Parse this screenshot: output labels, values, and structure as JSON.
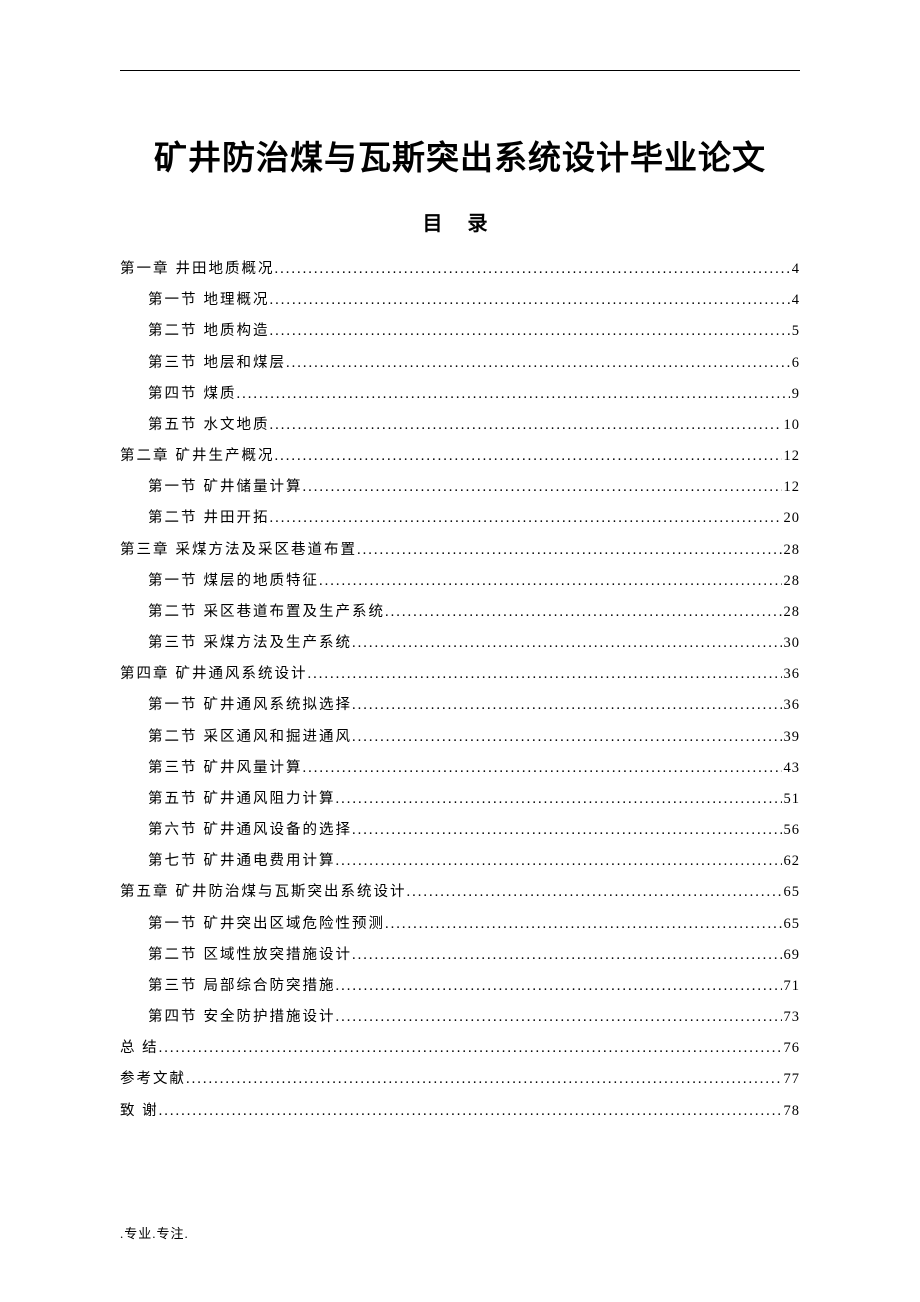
{
  "title": "矿井防治煤与瓦斯突出系统设计毕业论文",
  "toc_title": "目 录",
  "footer": ".专业.专注.",
  "toc": [
    {
      "level": 1,
      "label": "第一章",
      "text": "井田地质概况",
      "page": "4"
    },
    {
      "level": 2,
      "label": "第一节",
      "text": "地理概况",
      "page": "4"
    },
    {
      "level": 2,
      "label": "第二节",
      "text": "地质构造",
      "page": "5"
    },
    {
      "level": 2,
      "label": "第三节",
      "text": "地层和煤层",
      "page": "6"
    },
    {
      "level": 2,
      "label": "第四节",
      "text": "煤质",
      "page": "9"
    },
    {
      "level": 2,
      "label": "第五节",
      "text": "水文地质",
      "page": "10"
    },
    {
      "level": 1,
      "label": "第二章",
      "text": "矿井生产概况",
      "page": "12"
    },
    {
      "level": 2,
      "label": "第一节",
      "text": "矿井储量计算",
      "page": "12"
    },
    {
      "level": 2,
      "label": "第二节",
      "text": "井田开拓",
      "page": "20"
    },
    {
      "level": 1,
      "label": "第三章",
      "text": "采煤方法及采区巷道布置",
      "page": "28"
    },
    {
      "level": 2,
      "label": "第一节",
      "text": "煤层的地质特征",
      "page": "28"
    },
    {
      "level": 2,
      "label": "第二节",
      "text": "采区巷道布置及生产系统",
      "page": "28"
    },
    {
      "level": 2,
      "label": "第三节",
      "text": "采煤方法及生产系统",
      "page": "30"
    },
    {
      "level": 1,
      "label": "第四章",
      "text": "矿井通风系统设计",
      "page": "36"
    },
    {
      "level": 2,
      "label": "第一节",
      "text": "矿井通风系统拟选择",
      "page": "36"
    },
    {
      "level": 2,
      "label": "第二节",
      "text": "采区通风和掘进通风",
      "page": "39"
    },
    {
      "level": 2,
      "label": "第三节",
      "text": "矿井风量计算",
      "page": "43"
    },
    {
      "level": 2,
      "label": "第五节",
      "text": "矿井通风阻力计算",
      "page": "51"
    },
    {
      "level": 2,
      "label": "第六节",
      "text": "矿井通风设备的选择",
      "page": "56"
    },
    {
      "level": 2,
      "label": "第七节",
      "text": "矿井通电费用计算",
      "page": "62"
    },
    {
      "level": 1,
      "label": "第五章",
      "text": "矿井防治煤与瓦斯突出系统设计",
      "page": "65"
    },
    {
      "level": 2,
      "label": "第一节",
      "text": "矿井突出区域危险性预测",
      "page": "65"
    },
    {
      "level": 2,
      "label": "第二节",
      "text": "区域性放突措施设计",
      "page": "69"
    },
    {
      "level": 2,
      "label": "第三节",
      "text": "局部综合防突措施",
      "page": "71"
    },
    {
      "level": 2,
      "label": "第四节",
      "text": "安全防护措施设计",
      "page": "73"
    },
    {
      "level": 1,
      "label": "总 结",
      "text": "",
      "page": "76"
    },
    {
      "level": 1,
      "label": "参考文献",
      "text": "",
      "page": "77"
    },
    {
      "level": 1,
      "label": "致 谢",
      "text": "",
      "page": "78"
    }
  ]
}
